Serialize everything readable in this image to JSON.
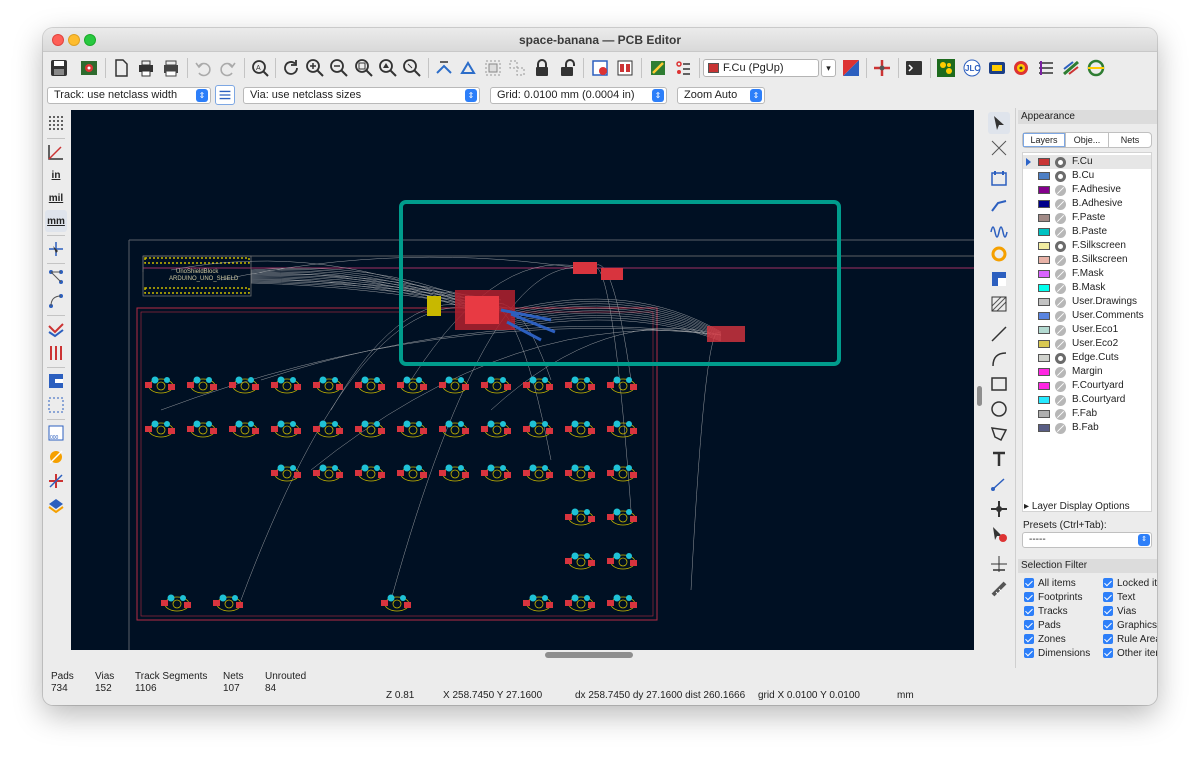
{
  "window": {
    "title": "space-banana — PCB Editor"
  },
  "toolbar": {
    "active_layer": "F.Cu (PgUp)",
    "active_layer_color": "#c83434",
    "icons": [
      "save-icon",
      "board-setup-icon",
      "page-settings-icon",
      "print-icon",
      "plot-icon",
      "undo-icon",
      "redo-icon",
      "find-icon",
      "refresh-icon",
      "zoom-in-icon",
      "zoom-out-icon",
      "zoom-fit-icon",
      "zoom-objects-icon",
      "zoom-selection-icon",
      "flip-view-icon",
      "rotate-ccw-icon",
      "rotate-cw-icon",
      "group-icon",
      "ungroup-icon",
      "lock-icon",
      "unlock-icon",
      "update-pcb-icon",
      "footprint-editor-icon",
      "drc-icon",
      "net-inspector-icon",
      "layer-pair-icon",
      "scripting-console-icon",
      "python-icon",
      "kicad-footprint-plugin-icon",
      "jlc-icon",
      "fabrication-icon",
      "interactive-router-icon",
      "highlight-icon",
      "replicate-icon",
      "teardrops-icon"
    ]
  },
  "auxbar": {
    "track": "Track: use netclass width",
    "via": "Via: use netclass sizes",
    "grid": "Grid: 0.0100 mm (0.0004 in)",
    "zoom": "Zoom Auto"
  },
  "left_toolbar": {
    "in_label": "in",
    "mil_label": "mil",
    "mm_label": "mm"
  },
  "canvas": {
    "background": "#001023",
    "selection_color": "#009c8c",
    "board_text_1": "UnoShieldBlock",
    "board_text_2": "ARDUINO_UNO_SHIELD"
  },
  "appearance": {
    "header": "Appearance",
    "tabs": [
      "Layers",
      "Obje...",
      "Nets"
    ],
    "layers": [
      {
        "name": "F.Cu",
        "color": "#c83434",
        "visible": true,
        "active": true
      },
      {
        "name": "B.Cu",
        "color": "#4d7fc4",
        "visible": true,
        "active": false
      },
      {
        "name": "F.Adhesive",
        "color": "#84008c",
        "visible": false,
        "active": false
      },
      {
        "name": "B.Adhesive",
        "color": "#00008c",
        "visible": false,
        "active": false
      },
      {
        "name": "F.Paste",
        "color": "#a18a86",
        "visible": false,
        "active": false
      },
      {
        "name": "B.Paste",
        "color": "#00c2c2",
        "visible": false,
        "active": false
      },
      {
        "name": "F.Silkscreen",
        "color": "#f2eda1",
        "visible": true,
        "active": false
      },
      {
        "name": "B.Silkscreen",
        "color": "#e8b2a7",
        "visible": false,
        "active": false
      },
      {
        "name": "F.Mask",
        "color": "#d864ff",
        "visible": false,
        "active": false
      },
      {
        "name": "B.Mask",
        "color": "#02ffee",
        "visible": false,
        "active": false
      },
      {
        "name": "User.Drawings",
        "color": "#c2c2c2",
        "visible": false,
        "active": false
      },
      {
        "name": "User.Comments",
        "color": "#5984e0",
        "visible": false,
        "active": false
      },
      {
        "name": "User.Eco1",
        "color": "#b4dbd2",
        "visible": false,
        "active": false
      },
      {
        "name": "User.Eco2",
        "color": "#d8c852",
        "visible": false,
        "active": false
      },
      {
        "name": "Edge.Cuts",
        "color": "#d0d2cd",
        "visible": true,
        "active": false
      },
      {
        "name": "Margin",
        "color": "#ff26e2",
        "visible": false,
        "active": false
      },
      {
        "name": "F.Courtyard",
        "color": "#ff26e2",
        "visible": false,
        "active": false
      },
      {
        "name": "B.Courtyard",
        "color": "#26e9ff",
        "visible": false,
        "active": false
      },
      {
        "name": "F.Fab",
        "color": "#afafaf",
        "visible": false,
        "active": false
      },
      {
        "name": "B.Fab",
        "color": "#585d84",
        "visible": false,
        "active": false
      }
    ],
    "layer_display_options": "Layer Display Options",
    "presets_label": "Presets (Ctrl+Tab):",
    "presets_value": "-----"
  },
  "selection_filter": {
    "header": "Selection Filter",
    "items": [
      "All items",
      "Locked it",
      "Footprints",
      "Text",
      "Tracks",
      "Vias",
      "Pads",
      "Graphics",
      "Zones",
      "Rule Area",
      "Dimensions",
      "Other iter"
    ]
  },
  "status": {
    "stats": [
      {
        "label": "Pads",
        "value": "734"
      },
      {
        "label": "Vias",
        "value": "152"
      },
      {
        "label": "Track Segments",
        "value": "1106"
      },
      {
        "label": "Nets",
        "value": "107"
      },
      {
        "label": "Unrouted",
        "value": "84"
      }
    ],
    "zoom": "Z 0.81",
    "xy": "X 258.7450  Y 27.1600",
    "delta": "dx 258.7450  dy 27.1600  dist 260.1666",
    "grid": "grid X 0.0100  Y 0.0100",
    "units": "mm"
  }
}
